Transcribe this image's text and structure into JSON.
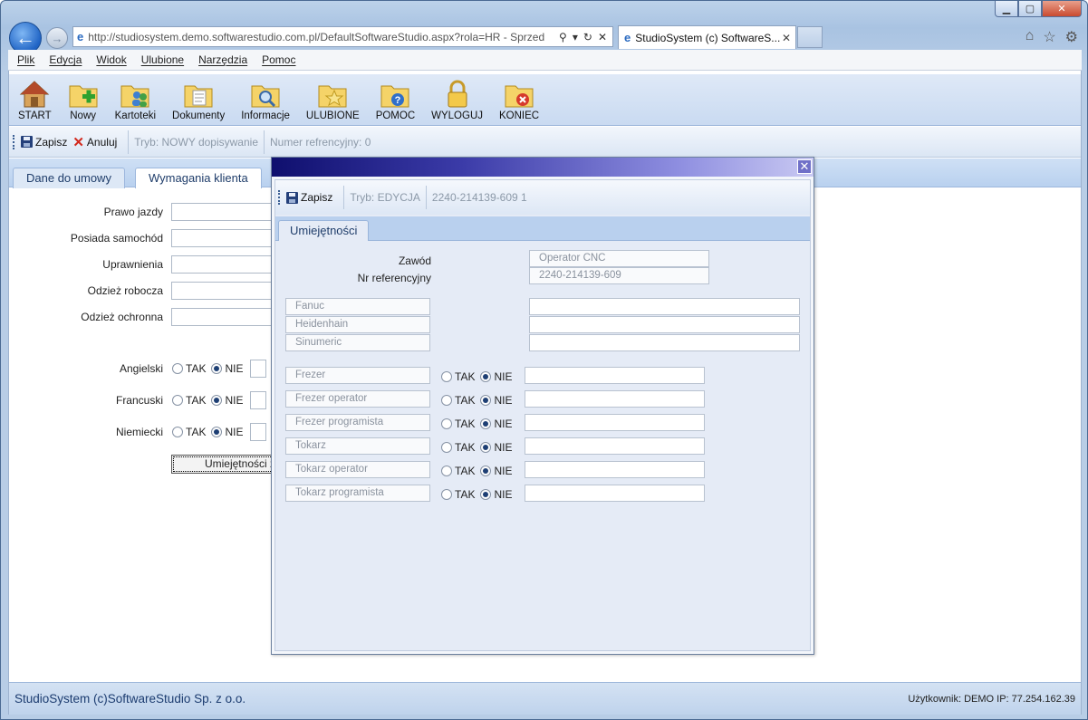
{
  "browser": {
    "url": "http://studiosystem.demo.softwarestudio.com.pl/DefaultSoftwareStudio.aspx?rola=HR - Sprzed",
    "tab_title": "StudioSystem (c) SoftwareS...",
    "tab_close": "✕",
    "menu": [
      "Plik",
      "Edycja",
      "Widok",
      "Ulubione",
      "Narzędzia",
      "Pomoc"
    ]
  },
  "toolbar": {
    "items": [
      {
        "label": "START",
        "icon": "home-icon"
      },
      {
        "label": "Nowy",
        "icon": "folder-plus-icon"
      },
      {
        "label": "Kartoteki",
        "icon": "folder-users-icon"
      },
      {
        "label": "Dokumenty",
        "icon": "folder-documents-icon"
      },
      {
        "label": "Informacje",
        "icon": "folder-search-icon"
      },
      {
        "label": "ULUBIONE",
        "icon": "folder-star-icon"
      },
      {
        "label": "POMOC",
        "icon": "folder-help-icon"
      },
      {
        "label": "WYLOGUJ",
        "icon": "lock-icon"
      },
      {
        "label": "KONIEC",
        "icon": "folder-close-icon"
      }
    ]
  },
  "actionbar": {
    "save": "Zapisz",
    "cancel": "Anuluj",
    "mode": "Tryb: NOWY dopisywanie",
    "ref": "Numer refrencyjny: 0"
  },
  "tabs": {
    "contract": "Dane do umowy",
    "requirements": "Wymagania klienta"
  },
  "form": {
    "fields": [
      "Prawo jazdy",
      "Posiada samochód",
      "Uprawnienia",
      "Odzież robocza",
      "Odzież ochronna"
    ],
    "languages": [
      {
        "label": "Angielski",
        "yes": "TAK",
        "no": "NIE",
        "selected": "NIE"
      },
      {
        "label": "Francuski",
        "yes": "TAK",
        "no": "NIE",
        "selected": "NIE"
      },
      {
        "label": "Niemiecki",
        "yes": "TAK",
        "no": "NIE",
        "selected": "NIE"
      }
    ],
    "skills_button": "Umiejętności z"
  },
  "modal": {
    "save": "Zapisz",
    "mode": "Tryb: EDYCJA",
    "ref": "2240-214139-609  1",
    "tab": "Umiejętności",
    "profession_label": "Zawód",
    "profession_value": "Operator CNC",
    "refno_label": "Nr referencyjny",
    "refno_value": "2240-214139-609",
    "controls": [
      "Fanuc",
      "Heidenhain",
      "Sinumeric"
    ],
    "skills": [
      {
        "name": "Frezer",
        "yes": "TAK",
        "no": "NIE",
        "selected": "NIE"
      },
      {
        "name": "Frezer operator",
        "yes": "TAK",
        "no": "NIE",
        "selected": "NIE"
      },
      {
        "name": "Frezer programista",
        "yes": "TAK",
        "no": "NIE",
        "selected": "NIE"
      },
      {
        "name": "Tokarz",
        "yes": "TAK",
        "no": "NIE",
        "selected": "NIE"
      },
      {
        "name": "Tokarz operator",
        "yes": "TAK",
        "no": "NIE",
        "selected": "NIE"
      },
      {
        "name": "Tokarz programista",
        "yes": "TAK",
        "no": "NIE",
        "selected": "NIE"
      }
    ]
  },
  "status": {
    "left": "StudioSystem (c)SoftwareStudio Sp. z o.o.",
    "right": "Użytkownik: DEMO IP: 77.254.162.39"
  }
}
